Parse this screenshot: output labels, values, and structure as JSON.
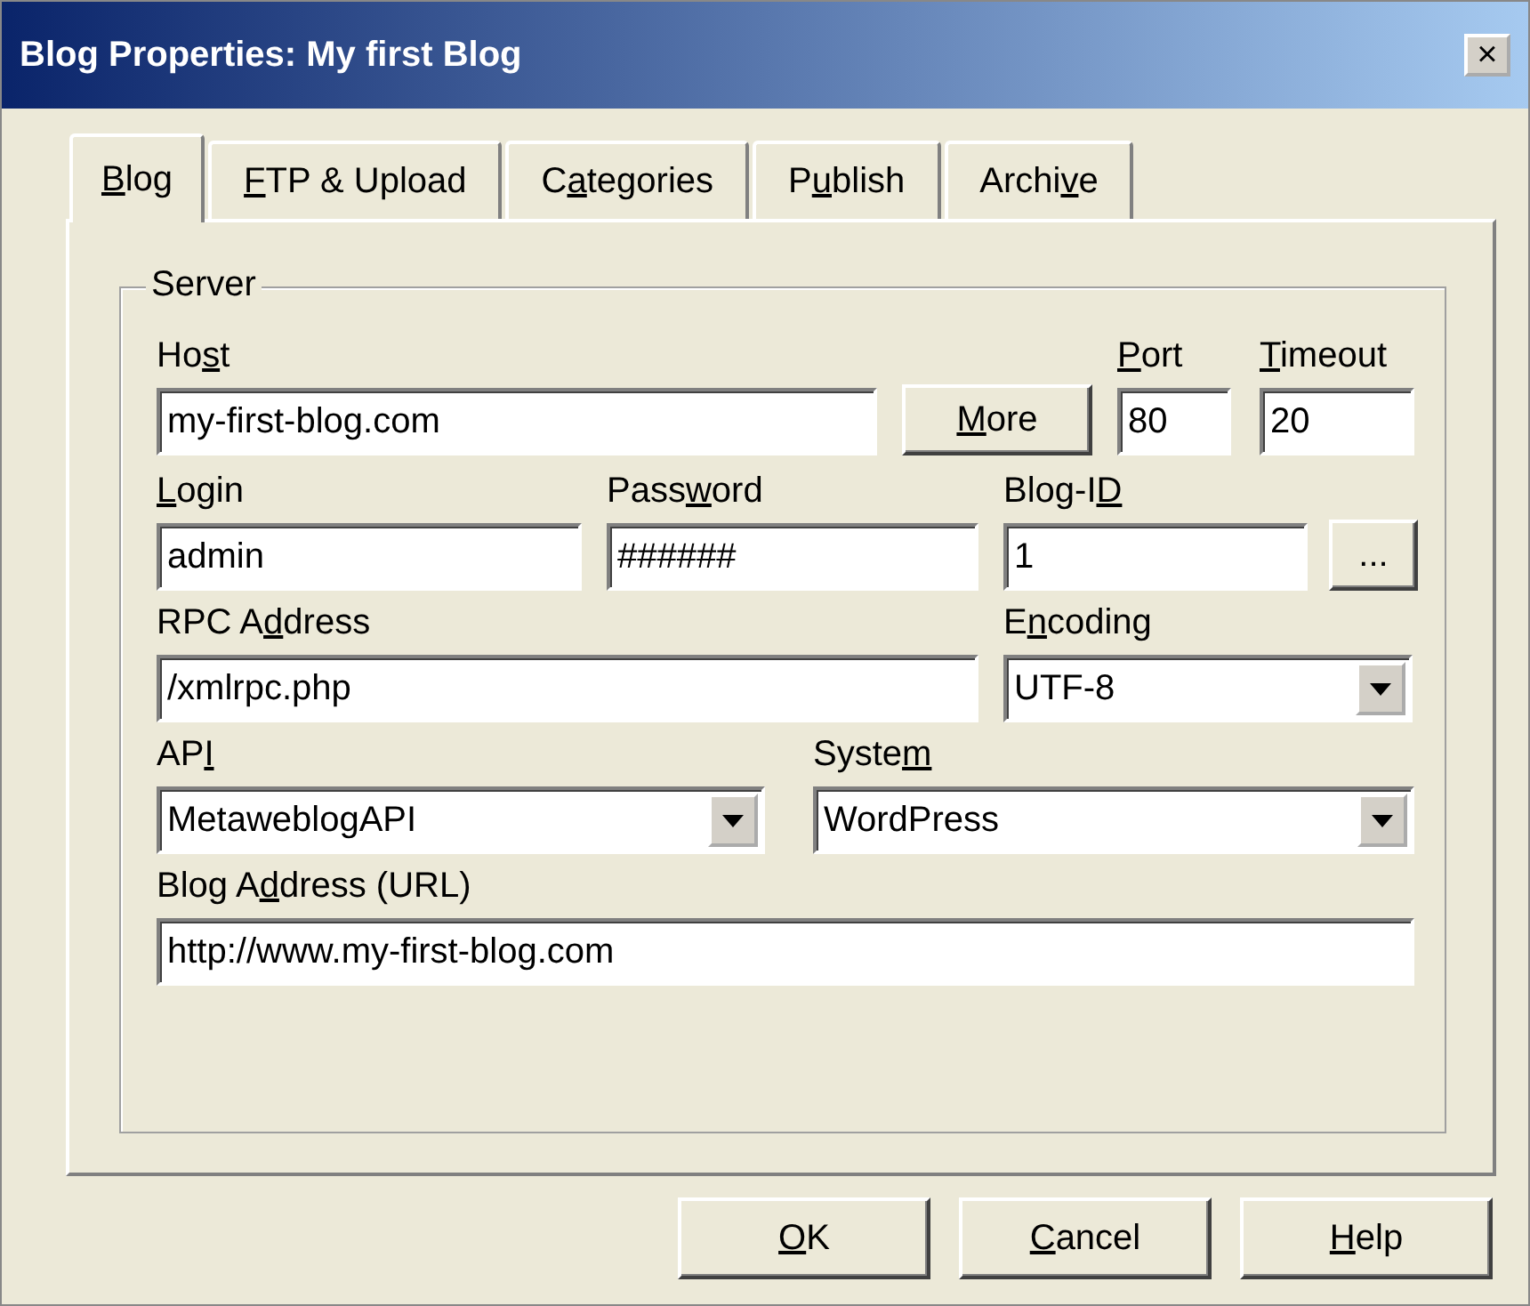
{
  "window": {
    "title": "Blog Properties: My first Blog",
    "close": "×"
  },
  "tabs": [
    {
      "label": {
        "key": "B",
        "post": "log"
      },
      "selected": true
    },
    {
      "label": {
        "key": "F",
        "post": "TP & Upload"
      },
      "selected": false
    },
    {
      "label": {
        "pre": "C",
        "key": "a",
        "post": "tegories"
      },
      "selected": false
    },
    {
      "label": {
        "pre": "P",
        "key": "u",
        "post": "blish"
      },
      "selected": false
    },
    {
      "label": {
        "pre": "Archi",
        "key": "v",
        "post": "e"
      },
      "selected": false
    }
  ],
  "group": {
    "title": "Server"
  },
  "rows": [
    [
      {
        "kind": "text",
        "label": {
          "pre": "Ho",
          "key": "s",
          "post": "t"
        },
        "value": "my-first-blog.com"
      },
      {
        "kind": "button",
        "label": {
          "key": "M",
          "post": "ore"
        }
      },
      {
        "kind": "text",
        "label": {
          "key": "P",
          "post": "ort"
        },
        "value": "80"
      },
      {
        "kind": "text",
        "label": {
          "key": "T",
          "post": "imeout"
        },
        "value": "20"
      }
    ],
    [
      {
        "kind": "text",
        "label": {
          "key": "L",
          "post": "ogin"
        },
        "value": "admin"
      },
      {
        "kind": "text",
        "label": {
          "pre": "Pass",
          "key": "w",
          "post": "ord"
        },
        "value": "######"
      },
      {
        "kind": "text",
        "label": {
          "pre": "Blog-I",
          "key": "D"
        },
        "value": "1"
      },
      {
        "kind": "button",
        "label": {
          "pre": "..."
        }
      }
    ],
    [
      {
        "kind": "text",
        "label": {
          "pre": "RPC A",
          "key": "d",
          "post": "dress"
        },
        "value": "/xmlrpc.php"
      },
      {
        "kind": "select",
        "label": {
          "pre": "E",
          "key": "n",
          "post": "coding"
        },
        "value": "UTF-8"
      }
    ],
    [
      {
        "kind": "select",
        "label": {
          "pre": "AP",
          "key": "I"
        },
        "value": "MetaweblogAPI"
      },
      {
        "kind": "select",
        "label": {
          "pre": "Syste",
          "key": "m"
        },
        "value": "WordPress"
      }
    ],
    [
      {
        "kind": "text",
        "label": {
          "pre": "Blog A",
          "key": "d",
          "post": "dress (URL)"
        },
        "value": "http://www.my-first-blog.com"
      }
    ]
  ],
  "buttons": [
    {
      "label": {
        "key": "O",
        "post": "K"
      }
    },
    {
      "label": {
        "key": "C",
        "post": "ancel"
      }
    },
    {
      "label": {
        "key": "H",
        "post": "elp"
      }
    }
  ]
}
